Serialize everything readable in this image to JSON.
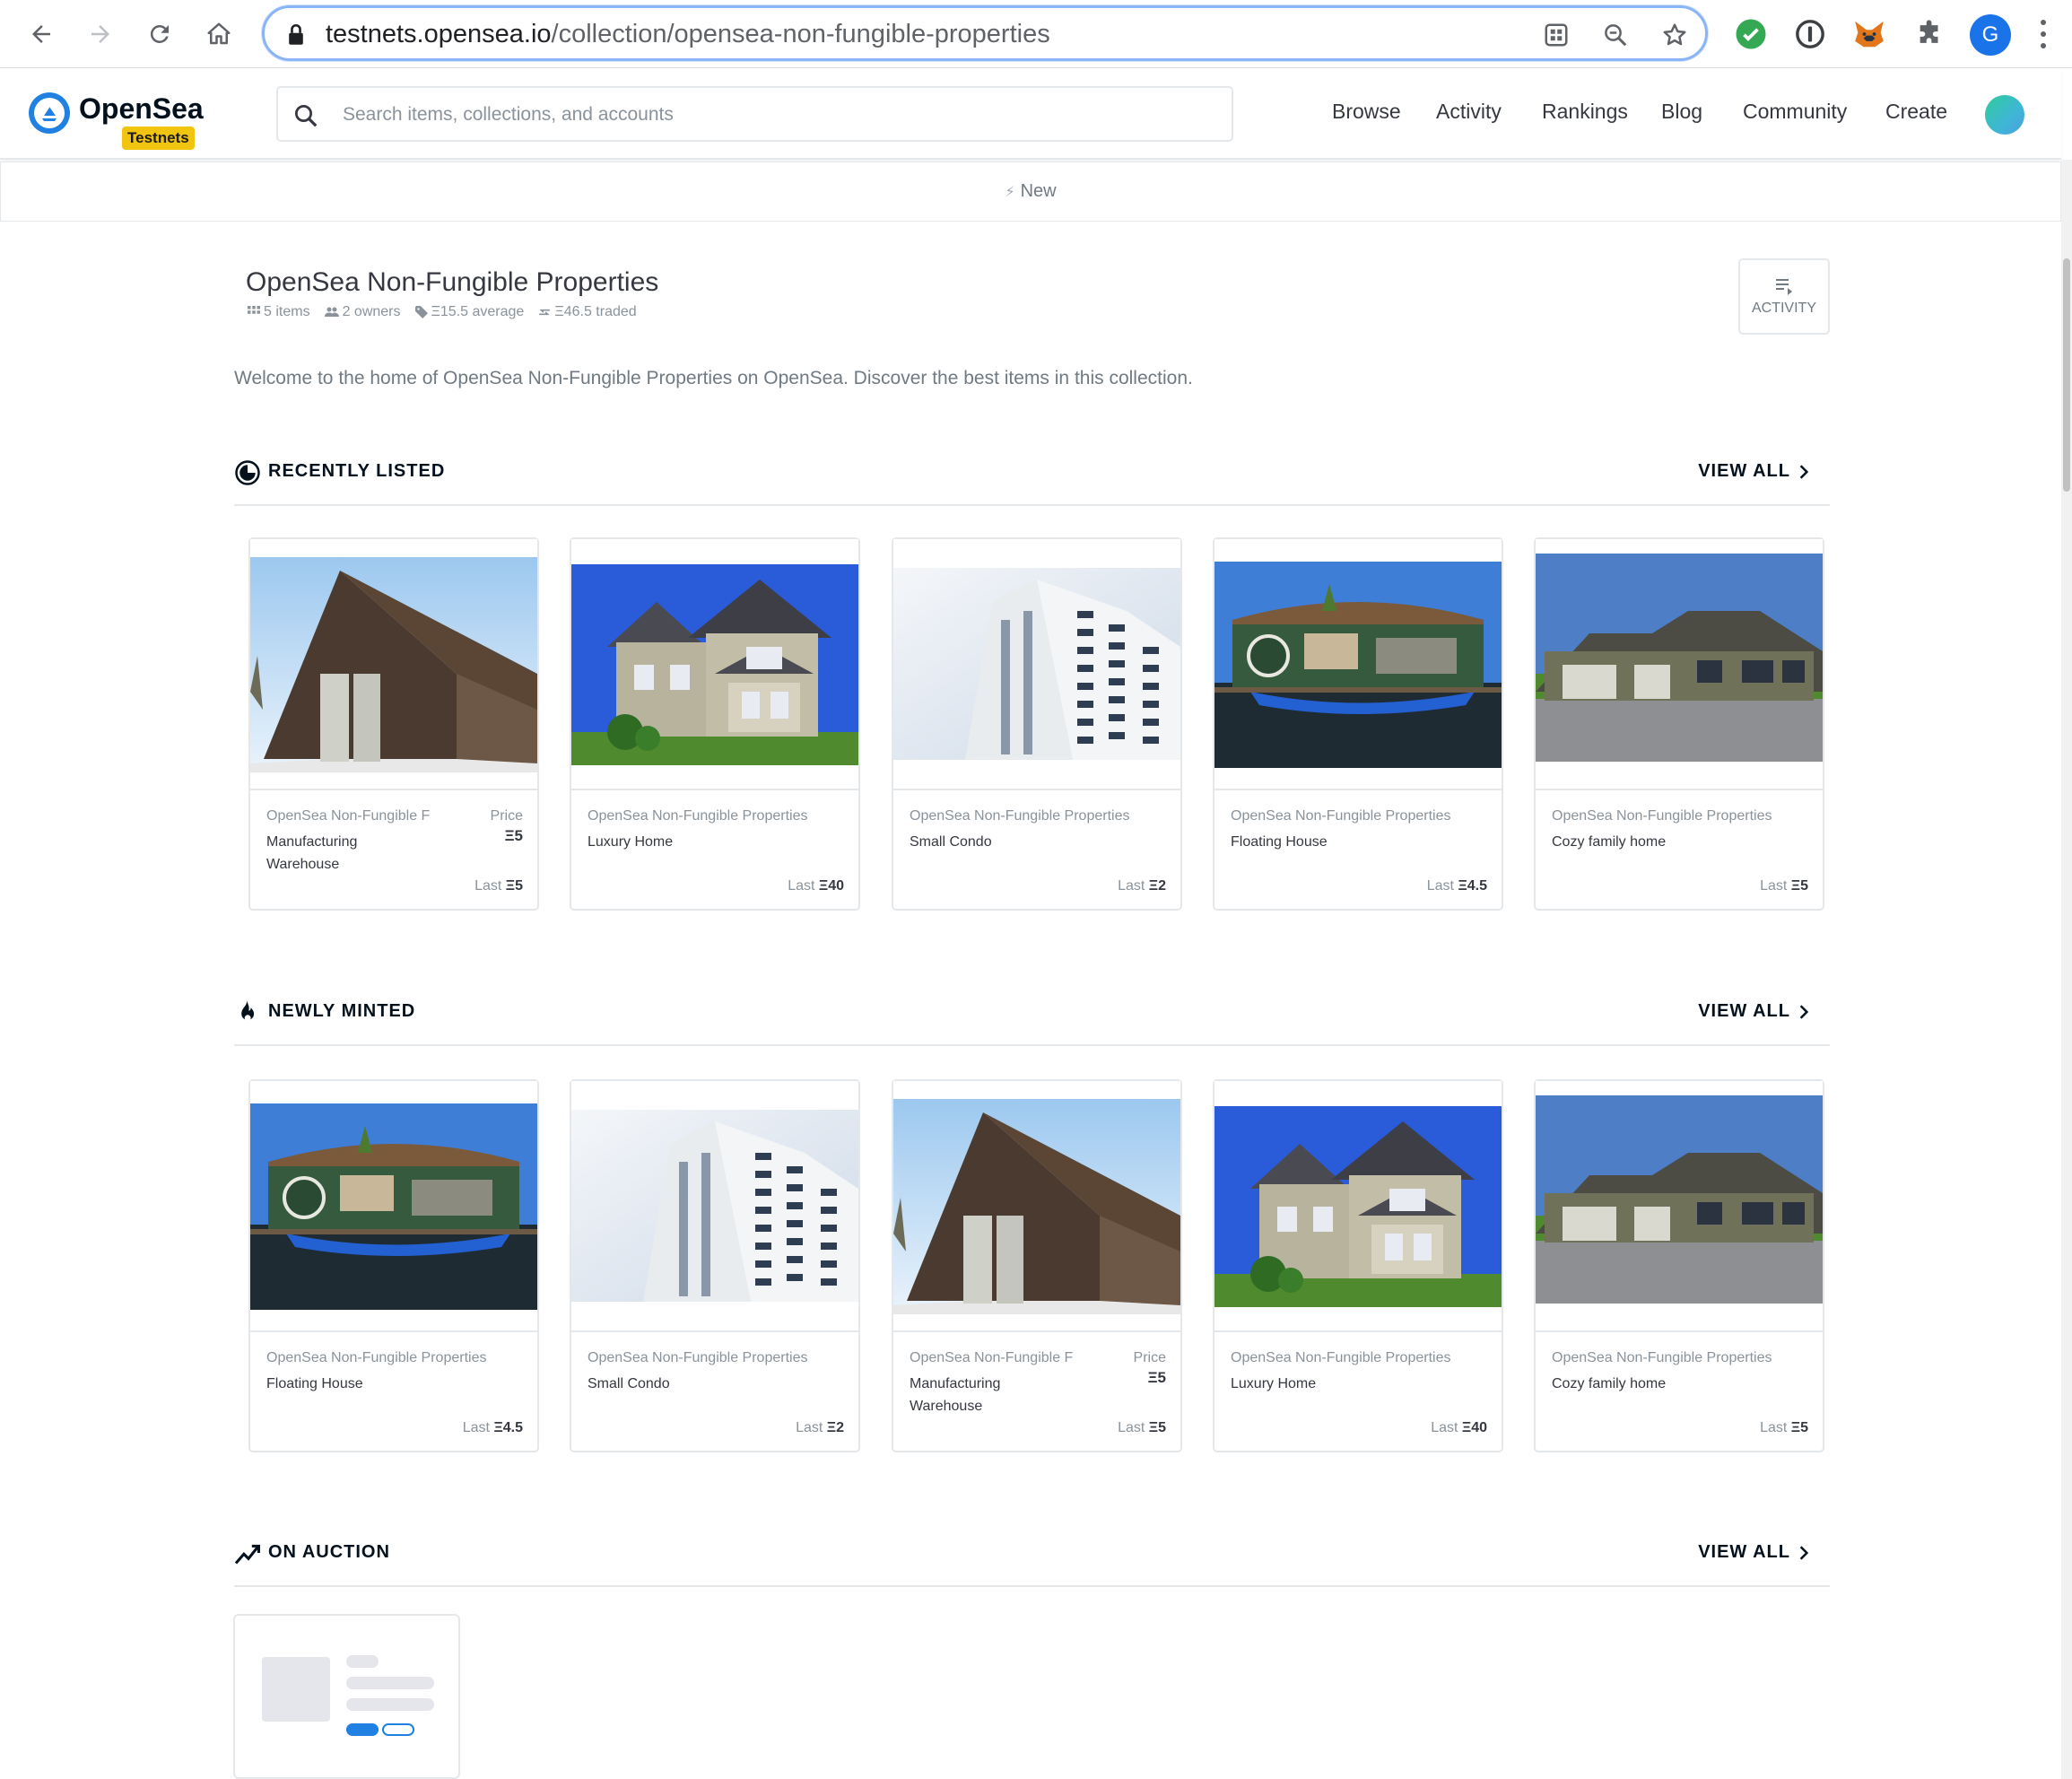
{
  "browser": {
    "url_host": "testnets.opensea.io",
    "url_path": "/collection/opensea-non-fungible-properties",
    "profile_initial": "G"
  },
  "header": {
    "brand": "OpenSea",
    "badge": "Testnets",
    "search_placeholder": "Search items, collections, and accounts",
    "nav": [
      "Browse",
      "Activity",
      "Rankings",
      "Blog",
      "Community",
      "Create"
    ]
  },
  "banner": {
    "label": "New"
  },
  "collection": {
    "title": "OpenSea Non-Fungible Properties",
    "stats": {
      "items": "5 items",
      "owners": "2 owners",
      "average": "Ξ15.5 average",
      "traded": "Ξ46.5 traded"
    },
    "activity_label": "ACTIVITY",
    "description": "Welcome to the home of OpenSea Non-Fungible Properties on OpenSea. Discover the best items in this collection."
  },
  "sections": {
    "recently_listed": {
      "title": "RECENTLY LISTED",
      "view_all": "VIEW ALL"
    },
    "newly_minted": {
      "title": "NEWLY MINTED",
      "view_all": "VIEW ALL"
    },
    "on_auction": {
      "title": "ON AUCTION",
      "view_all": "VIEW ALL"
    }
  },
  "recently_listed": [
    {
      "collection": "OpenSea Non-Fungible F",
      "name": "Manufacturing Warehouse",
      "price_label": "Price",
      "price": "Ξ5",
      "last_label": "Last",
      "last": "Ξ5",
      "image": "warehouse"
    },
    {
      "collection": "OpenSea Non-Fungible Properties",
      "name": "Luxury Home",
      "last_label": "Last",
      "last": "Ξ40",
      "image": "luxury-home"
    },
    {
      "collection": "OpenSea Non-Fungible Properties",
      "name": "Small Condo",
      "last_label": "Last",
      "last": "Ξ2",
      "image": "condo"
    },
    {
      "collection": "OpenSea Non-Fungible Properties",
      "name": "Floating House",
      "last_label": "Last",
      "last": "Ξ4.5",
      "image": "floating-house"
    },
    {
      "collection": "OpenSea Non-Fungible Properties",
      "name": "Cozy family home",
      "last_label": "Last",
      "last": "Ξ5",
      "image": "family-home"
    }
  ],
  "newly_minted": [
    {
      "collection": "OpenSea Non-Fungible Properties",
      "name": "Floating House",
      "last_label": "Last",
      "last": "Ξ4.5",
      "image": "floating-house"
    },
    {
      "collection": "OpenSea Non-Fungible Properties",
      "name": "Small Condo",
      "last_label": "Last",
      "last": "Ξ2",
      "image": "condo"
    },
    {
      "collection": "OpenSea Non-Fungible F",
      "name": "Manufacturing Warehouse",
      "price_label": "Price",
      "price": "Ξ5",
      "last_label": "Last",
      "last": "Ξ5",
      "image": "warehouse"
    },
    {
      "collection": "OpenSea Non-Fungible Properties",
      "name": "Luxury Home",
      "last_label": "Last",
      "last": "Ξ40",
      "image": "luxury-home"
    },
    {
      "collection": "OpenSea Non-Fungible Properties",
      "name": "Cozy family home",
      "last_label": "Last",
      "last": "Ξ5",
      "image": "family-home"
    }
  ],
  "colors": {
    "brand_blue": "#2081e2",
    "badge_yellow": "#f1c40f",
    "text_dark": "#04111d",
    "text_muted": "#8a939b"
  }
}
